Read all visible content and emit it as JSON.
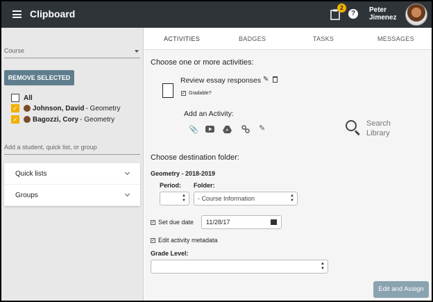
{
  "header": {
    "app_title": "Clipboard",
    "notification_count": "2",
    "help_glyph": "?",
    "user_first": "Peter",
    "user_last": "Jimenez",
    "icons": {
      "menu": "hamburger-icon",
      "clipboard": "clipboard-icon",
      "help": "help-icon"
    }
  },
  "sidebar": {
    "course_placeholder": "Course",
    "remove_selected_label": "REMOVE SELECTED",
    "all_label": "All",
    "students": [
      {
        "name": "Johnson, David",
        "course": "- Geometry",
        "checked": true
      },
      {
        "name": "Bagozzi, Cory",
        "course": "- Geometry",
        "checked": true
      }
    ],
    "add_placeholder": "Add a student, quick list, or group",
    "accordion": [
      {
        "label": "Quick lists"
      },
      {
        "label": "Groups"
      }
    ]
  },
  "tabs": [
    {
      "label": "ACTIVITIES",
      "active": true
    },
    {
      "label": "BADGES",
      "active": false
    },
    {
      "label": "TASKS",
      "active": false
    },
    {
      "label": "MESSAGES",
      "active": false
    }
  ],
  "activities": {
    "choose_title": "Choose one or more activities:",
    "activity_name": "Review essay responses",
    "gradable_label": "Gradable?",
    "gradable_checked": true,
    "add_activity_label": "Add an Activity:",
    "add_icons": [
      "paperclip-icon",
      "youtube-icon",
      "google-drive-icon",
      "link-icon",
      "pencil-icon"
    ],
    "search_library_line1": "Search",
    "search_library_line2": "Library"
  },
  "destination": {
    "title": "Choose destination folder:",
    "course_heading": "Geometry - 2018-2019",
    "period_label": "Period:",
    "period_value": "",
    "folder_label": "Folder:",
    "folder_value": "- Course Information",
    "set_due_date_label": "Set due date",
    "set_due_date_checked": true,
    "due_date": "11/28/17",
    "edit_metadata_label": "Edit activity metadata",
    "edit_metadata_checked": true,
    "grade_level_label": "Grade Level:",
    "grade_level_value": ""
  },
  "actions": {
    "edit_assign_label": "Edit and Assign"
  },
  "colors": {
    "topbar": "#2f3438",
    "accent_yellow": "#f2b100",
    "remove_button": "#5f7d8d",
    "edit_assign_button": "#8aa3b0"
  }
}
